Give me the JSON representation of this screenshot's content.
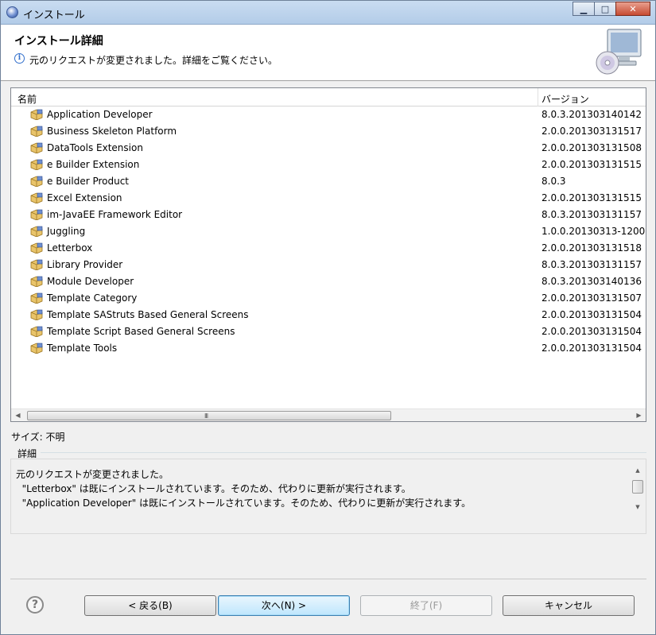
{
  "window": {
    "title": "インストール",
    "controls": {
      "minimize": "▁",
      "maximize": "□",
      "close": "✕"
    }
  },
  "banner": {
    "title": "インストール詳細",
    "message": "元のリクエストが変更されました。詳細をご覧ください。"
  },
  "table": {
    "columns": {
      "name": "名前",
      "version": "バージョン"
    },
    "rows": [
      {
        "name": "Application Developer",
        "version": "8.0.3.201303140142"
      },
      {
        "name": "Business Skeleton Platform",
        "version": "2.0.0.201303131517"
      },
      {
        "name": "DataTools Extension",
        "version": "2.0.0.201303131508"
      },
      {
        "name": "e Builder Extension",
        "version": "2.0.0.201303131515"
      },
      {
        "name": "e Builder Product",
        "version": "8.0.3"
      },
      {
        "name": "Excel Extension",
        "version": "2.0.0.201303131515"
      },
      {
        "name": "im-JavaEE Framework Editor",
        "version": "8.0.3.201303131157"
      },
      {
        "name": "Juggling",
        "version": "1.0.0.20130313-1200"
      },
      {
        "name": "Letterbox",
        "version": "2.0.0.201303131518"
      },
      {
        "name": "Library Provider",
        "version": "8.0.3.201303131157"
      },
      {
        "name": "Module Developer",
        "version": "8.0.3.201303140136"
      },
      {
        "name": "Template Category",
        "version": "2.0.0.201303131507"
      },
      {
        "name": "Template SAStruts Based General Screens",
        "version": "2.0.0.201303131504"
      },
      {
        "name": "Template Script Based General Screens",
        "version": "2.0.0.201303131504"
      },
      {
        "name": "Template Tools",
        "version": "2.0.0.201303131504"
      }
    ],
    "scroll_grip": "III"
  },
  "size": {
    "text": "サイズ: 不明"
  },
  "details": {
    "label": "詳細",
    "lines": [
      "元のリクエストが変更されました。",
      "  \"Letterbox\" は既にインストールされています。そのため、代わりに更新が実行されます。",
      "  \"Application Developer\" は既にインストールされています。そのため、代わりに更新が実行されます。"
    ]
  },
  "buttons": {
    "back": "< 戻る(B)",
    "next": "次へ(N) >",
    "finish": "終了(F)",
    "cancel": "キャンセル"
  },
  "help": {
    "glyph": "?"
  },
  "colors": {
    "accent": "#3c7fb1",
    "window_bg": "#f0f0f0",
    "close_button": "#c74b32"
  }
}
